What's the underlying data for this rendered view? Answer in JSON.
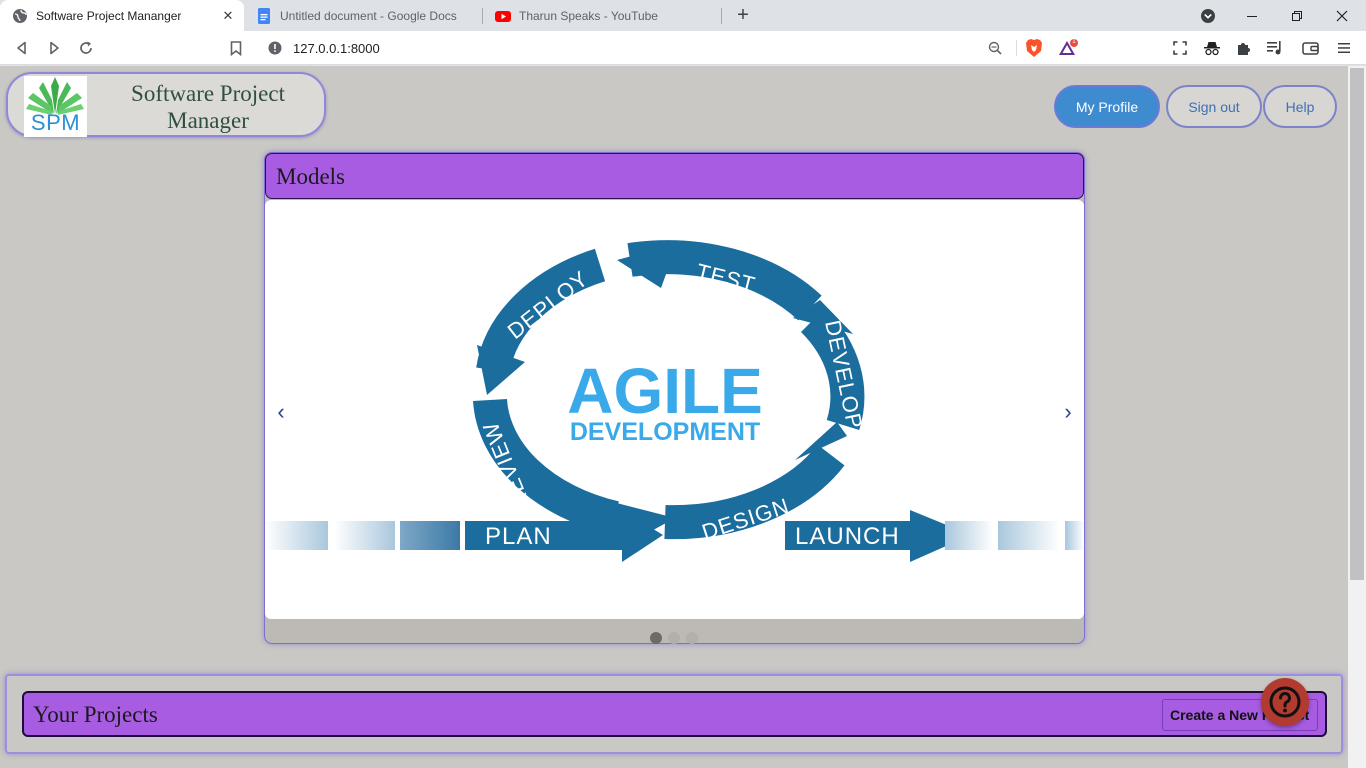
{
  "browser": {
    "tabs": [
      {
        "title": "Software Project Mananger",
        "icon": "globe-icon",
        "active": true
      },
      {
        "title": "Untitled document - Google Docs",
        "icon": "google-docs-icon",
        "active": false
      },
      {
        "title": "Tharun Speaks - YouTube",
        "icon": "youtube-icon",
        "active": false
      }
    ],
    "new_tab_label": "+",
    "url": "127.0.0.1:8000",
    "shield_badge": "1"
  },
  "header": {
    "logo_text": "SPM",
    "app_title": "Software Project Manager",
    "nav": {
      "profile_label": "My Profile",
      "signout_label": "Sign out",
      "help_label": "Help"
    }
  },
  "models": {
    "title": "Models",
    "prev_label": "‹",
    "next_label": "›",
    "slide": {
      "headline": "AGILE",
      "subheadline": "DEVELOPMENT",
      "cycle_labels": [
        "DEPLOY",
        "TEST",
        "DEVELOP",
        "DESIGN",
        "REVIEW"
      ],
      "timeline_labels": [
        "PLAN",
        "LAUNCH"
      ]
    },
    "indicator_count": 3,
    "active_indicator": 1
  },
  "projects": {
    "title": "Your Projects",
    "create_label": "Create a New Project"
  },
  "colors": {
    "accent_purple": "#a75ce2",
    "primary_blue": "#3f8bd0",
    "agile_blue": "#1b6d9e",
    "agile_light": "#3aa9ea",
    "help_red": "#b23a2e"
  }
}
